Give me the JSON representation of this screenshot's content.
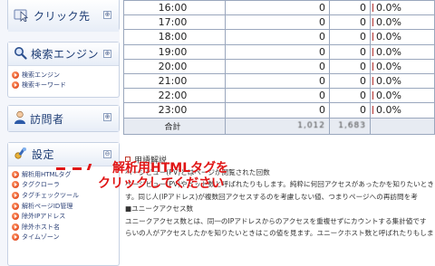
{
  "sidebar": {
    "click_panel": {
      "title": "クリック先",
      "toggle": "⊕"
    },
    "search_panel": {
      "title": "検索エンジン",
      "toggle": "⊕",
      "items": [
        "検索エンジン",
        "検索キーワード"
      ]
    },
    "visitor_panel": {
      "title": "訪問者",
      "toggle": "⊕"
    },
    "settings_panel": {
      "title": "設定",
      "toggle": "⊖",
      "items": [
        "解析用HTMLタグ",
        "タグクローラ",
        "タグチェックツール",
        "解析ページID管理",
        "除外IPアドレス",
        "除外ホスト名",
        "タイムゾーン"
      ]
    }
  },
  "table": {
    "rows": [
      {
        "hour": "16:00",
        "count": "0",
        "count2": "0",
        "pct": "0.0%"
      },
      {
        "hour": "17:00",
        "count": "0",
        "count2": "0",
        "pct": "0.0%"
      },
      {
        "hour": "18:00",
        "count": "0",
        "count2": "0",
        "pct": "0.0%"
      },
      {
        "hour": "19:00",
        "count": "0",
        "count2": "0",
        "pct": "0.0%"
      },
      {
        "hour": "20:00",
        "count": "0",
        "count2": "0",
        "pct": "0.0%"
      },
      {
        "hour": "21:00",
        "count": "0",
        "count2": "0",
        "pct": "0.0%"
      },
      {
        "hour": "22:00",
        "count": "0",
        "count2": "0",
        "pct": "0.0%"
      },
      {
        "hour": "23:00",
        "count": "0",
        "count2": "0",
        "pct": "0.0%"
      }
    ],
    "total": {
      "label": "合計",
      "count": "1,012",
      "count2": "1,683"
    }
  },
  "glossary": {
    "heading": "用語解説",
    "lines": [
      "ページビュー(PV)とはページが閲覧された回数",
      "ページビュー(PV)やヒット数と呼ばれたりもします。純粋に何回アクセスがあったかを知りたいとき",
      "す。同じ人(IPアドレス)が複数回アクセスするのを考慮しない値、つまりページへの再訪問を考",
      "■ユニークアクセス数",
      "ユニークアクセス数とは、同一のIPアドレスからのアクセスを重複せずにカウントする集計値です",
      "らいの人がアクセスしたかを知りたいときはこの値を見ます。ユニークホスト数と呼ばれたりもしま"
    ]
  },
  "annotation": {
    "line1": "解析用HTMLタグを",
    "line2": "クリックしてください",
    "color": "#e01515"
  }
}
